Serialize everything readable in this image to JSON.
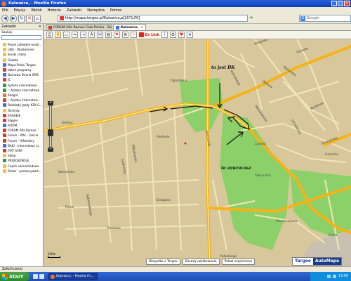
{
  "window": {
    "title": "Katowice, - Mozilla Firefox"
  },
  "menu": [
    "Plik",
    "Edycja",
    "Widok",
    "Historia",
    "Zakładki",
    "Narzędzia",
    "Pomoc"
  ],
  "nav": {
    "url": "http://mapa.targeo.pl/Katowice,p[20?1,P0]",
    "search_placeholder": "Google"
  },
  "sidebar": {
    "header": "Zakładki",
    "search_label": "Szukaj:",
    "items": [
      {
        "label": "Pasek zakładek osobi...",
        "color": "#e8c14a"
      },
      {
        "label": "LIKE - Wiadomości",
        "color": "#e8c14a"
      },
      {
        "label": "Ikonki chello",
        "color": "#e8c14a"
      },
      {
        "label": "Gazeta",
        "color": "#e8c14a"
      },
      {
        "label": "Mapa Polski Targeo",
        "color": "#3a6ed8"
      },
      {
        "label": "dobre programy",
        "color": "#d23a2a"
      },
      {
        "label": "Domowa Strona SMS",
        "color": "#3a6ed8"
      },
      {
        "label": "JC",
        "color": "#d23a2a"
      },
      {
        "label": "Aptoka internetowa...",
        "color": "#2a9a4a"
      },
      {
        "label": ":: Apteka internetowa",
        "color": "#2a9a4a"
      },
      {
        "label": "Allegro",
        "color": "#e8762b"
      },
      {
        "label": ":: Aptoka internetow...",
        "color": "#d23a2a"
      },
      {
        "label": "Rozkłady Jazdy KZK G...",
        "color": "#3a6ed8"
      },
      {
        "label": "Torrenty",
        "color": "#e8c14a"
      },
      {
        "label": "ZAGAĘIE",
        "color": "#d23a2a"
      },
      {
        "label": "Ślągiec",
        "color": "#d23a2a"
      },
      {
        "label": "ROOM",
        "color": "#3a6ed8"
      },
      {
        "label": "FORUM Alfa Romeo",
        "color": "#d23a2a"
      },
      {
        "label": "Forum - Alfa - Lancia",
        "color": "#d23a2a"
      },
      {
        "label": "Forum - Alfaholicy",
        "color": "#d23a2a"
      },
      {
        "label": "BAKI - Internetowy si...",
        "color": "#3a6ed8"
      },
      {
        "label": "FIAT AFER",
        "color": "#d23a2a"
      },
      {
        "label": "Sklep",
        "color": "#e8c14a"
      },
      {
        "label": "PRZEDSZKOLE",
        "color": "#2a9a4a"
      },
      {
        "label": "Części samochodowe",
        "color": "#e8c14a"
      },
      {
        "label": "Radar - porównywark...",
        "color": "#e8c14a"
      }
    ]
  },
  "tabs": [
    {
      "label": "FORUM Alfa Romeo Club Polska - Skąd F...",
      "active": false
    },
    {
      "label": "Katowice,",
      "active": true
    }
  ],
  "map_toolbar": {
    "link_label": "Dx Link"
  },
  "map": {
    "annotations": {
      "dk": "to jest DK",
      "turn": "to zawracasz"
    },
    "streets": [
      "Kolejowa",
      "Katowicka",
      "Dąbrowskiego",
      "Szafranka",
      "Mikołowska",
      "Podlesie",
      "Kościuszki",
      "Warszawska",
      "Zielona",
      "Piekarska",
      "Kolejowa",
      "Strzelecka",
      "Słowiańska",
      "Gliwicka",
      "Cicha",
      "Kilińskiego",
      "Lipowa",
      "Polna",
      "Drogowa",
      "Parkowa",
      "Pułaskiego",
      "Modrzewiowa",
      "Okólna",
      "Osiedle",
      "Fabryczna",
      "Ogrodowa"
    ],
    "bottom_links": [
      "Wszystko o Targeo",
      "Zasady użytkowania",
      "Pokaż znajomemu"
    ],
    "logo": {
      "left": "Targeo",
      "right": "AutoMapa"
    },
    "scale": "200m"
  },
  "status": "Zakończono",
  "taskbar": {
    "start": "Start",
    "task": "Katowice, - Mozilla Fir...",
    "clock": "15:09"
  }
}
